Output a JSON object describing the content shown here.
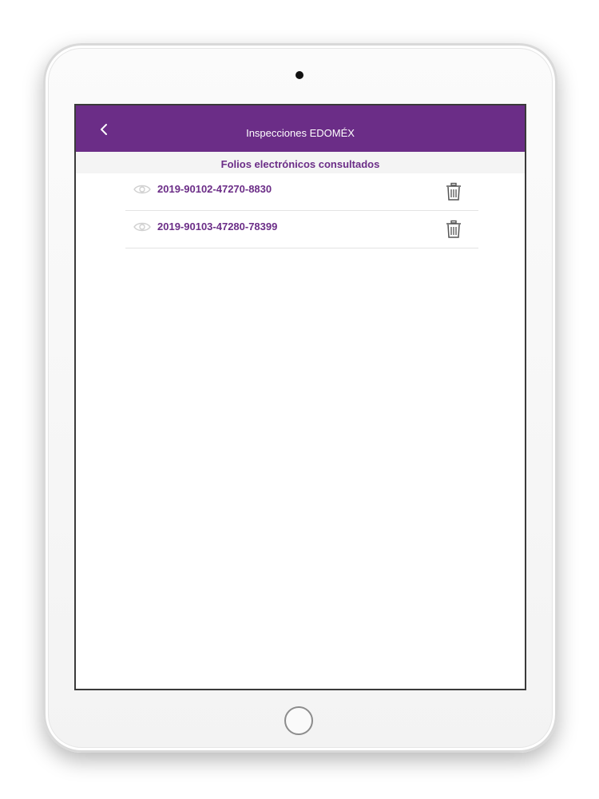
{
  "app_bar": {
    "title": "Inspecciones EDOMÉX",
    "back_icon": "chevron-left-icon"
  },
  "subheader": {
    "title": "Folios electrónicos consultados"
  },
  "folios": [
    {
      "number": "2019-90102-47270-8830",
      "view_icon": "eye-icon",
      "delete_icon": "trash-icon"
    },
    {
      "number": "2019-90103-47280-78399",
      "view_icon": "eye-icon",
      "delete_icon": "trash-icon"
    }
  ],
  "colors": {
    "brand_purple": "#6b2d87",
    "subheader_bg": "#f4f4f4",
    "divider": "#e3e3e3"
  }
}
